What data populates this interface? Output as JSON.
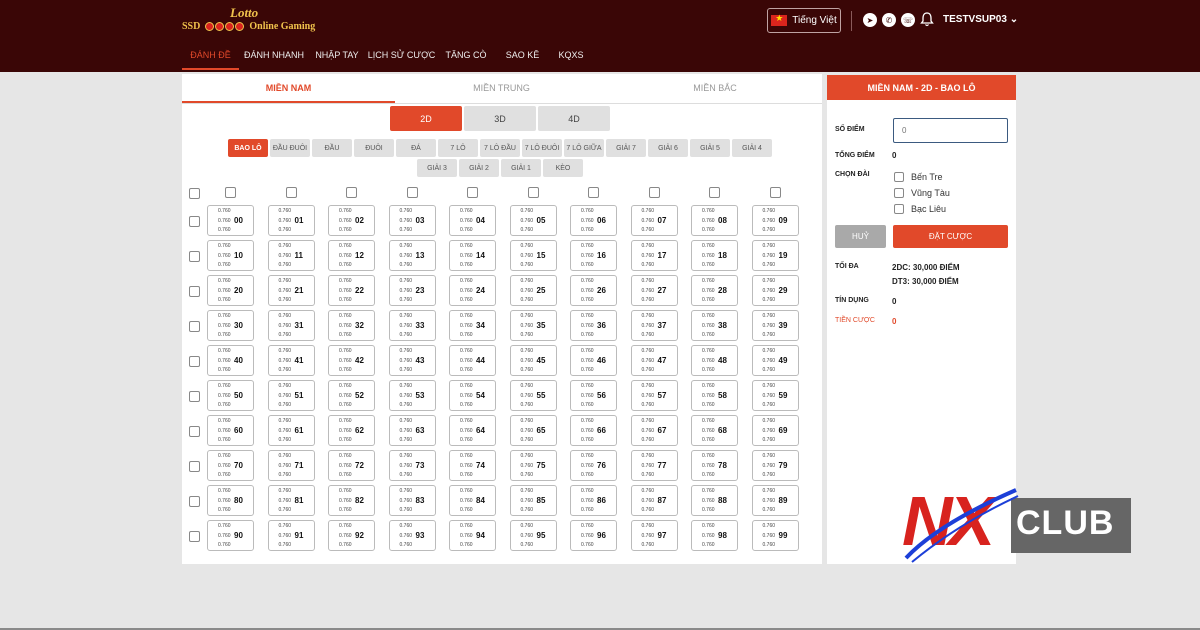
{
  "logo": {
    "line1": "Lotto",
    "line2_left": "SSD",
    "line2_right": "Online Gaming"
  },
  "header": {
    "language": "Tiếng Việt",
    "username": "TESTVSUP03",
    "icons": [
      "telegram-icon",
      "viber-icon",
      "whatsapp-icon",
      "bell-icon"
    ]
  },
  "nav": {
    "items": [
      {
        "label": "ĐÁNH ĐỀ"
      },
      {
        "label": "ĐÁNH NHANH"
      },
      {
        "label": "NHẬP TAY"
      },
      {
        "label": "LỊCH SỬ CƯỢC"
      },
      {
        "label": "TĂNG CÒ"
      },
      {
        "label": "SAO KÊ"
      },
      {
        "label": "KQXS"
      }
    ],
    "active": 0
  },
  "region_tabs": {
    "items": [
      {
        "label": "MIỀN NAM"
      },
      {
        "label": "MIỀN TRUNG"
      },
      {
        "label": "MIỀN BẮC"
      }
    ],
    "active": 0
  },
  "digit_tabs": {
    "items": [
      {
        "label": "2D"
      },
      {
        "label": "3D"
      },
      {
        "label": "4D"
      }
    ],
    "active": 0
  },
  "bet_types": {
    "items": [
      {
        "label": "BAO LÔ"
      },
      {
        "label": "ĐẦU ĐUÔI"
      },
      {
        "label": "ĐẦU"
      },
      {
        "label": "ĐUÔI"
      },
      {
        "label": "ĐÁ"
      },
      {
        "label": "7 LÔ"
      },
      {
        "label": "7 LÔ ĐẦU"
      },
      {
        "label": "7 LÔ ĐUÔI"
      },
      {
        "label": "7 LÔ GIỮA"
      },
      {
        "label": "GIẢI 7"
      },
      {
        "label": "GIẢI 6"
      },
      {
        "label": "GIẢI 5"
      },
      {
        "label": "GIẢI 4"
      },
      {
        "label": "GIẢI 3"
      },
      {
        "label": "GIẢI 2"
      },
      {
        "label": "GIẢI 1"
      },
      {
        "label": "KÈO"
      }
    ],
    "active": 0
  },
  "grid": {
    "odds": "0.760",
    "numbers": [
      "00",
      "01",
      "02",
      "03",
      "04",
      "05",
      "06",
      "07",
      "08",
      "09",
      "10",
      "11",
      "12",
      "13",
      "14",
      "15",
      "16",
      "17",
      "18",
      "19",
      "20",
      "21",
      "22",
      "23",
      "24",
      "25",
      "26",
      "27",
      "28",
      "29",
      "30",
      "31",
      "32",
      "33",
      "34",
      "35",
      "36",
      "37",
      "38",
      "39",
      "40",
      "41",
      "42",
      "43",
      "44",
      "45",
      "46",
      "47",
      "48",
      "49",
      "50",
      "51",
      "52",
      "53",
      "54",
      "55",
      "56",
      "57",
      "58",
      "59",
      "60",
      "61",
      "62",
      "63",
      "64",
      "65",
      "66",
      "67",
      "68",
      "69",
      "70",
      "71",
      "72",
      "73",
      "74",
      "75",
      "76",
      "77",
      "78",
      "79",
      "80",
      "81",
      "82",
      "83",
      "84",
      "85",
      "86",
      "87",
      "88",
      "89",
      "90",
      "91",
      "92",
      "93",
      "94",
      "95",
      "96",
      "97",
      "98",
      "99"
    ]
  },
  "side": {
    "title": "MIỀN NAM - 2D - BAO LÔ",
    "score_label": "SỐ ĐIỂM",
    "score_placeholder": "0",
    "total_label": "TỔNG ĐIỂM",
    "total_value": "0",
    "station_label": "CHỌN ĐÀI",
    "stations": [
      {
        "label": "Bến Tre"
      },
      {
        "label": "Vũng Tàu"
      },
      {
        "label": "Bạc Liêu"
      }
    ],
    "cancel_label": "HUỶ",
    "bet_label": "ĐẶT CƯỢC",
    "max_label": "TỐI ĐA",
    "max_2dc": "2DC: 30,000 ĐIỂM",
    "max_dt3": "DT3: 30,000 ĐIỂM",
    "credit_label": "TÍN DỤNG",
    "credit_value": "0",
    "bet_money_label": "TIỀN CƯỢC",
    "bet_money_value": "0"
  },
  "watermark": {
    "left": "NX",
    "right": "CLUB"
  },
  "colors": {
    "header_bg": "#3a0606",
    "accent": "#e1492a",
    "tab_bg": "#e0e0e0"
  }
}
